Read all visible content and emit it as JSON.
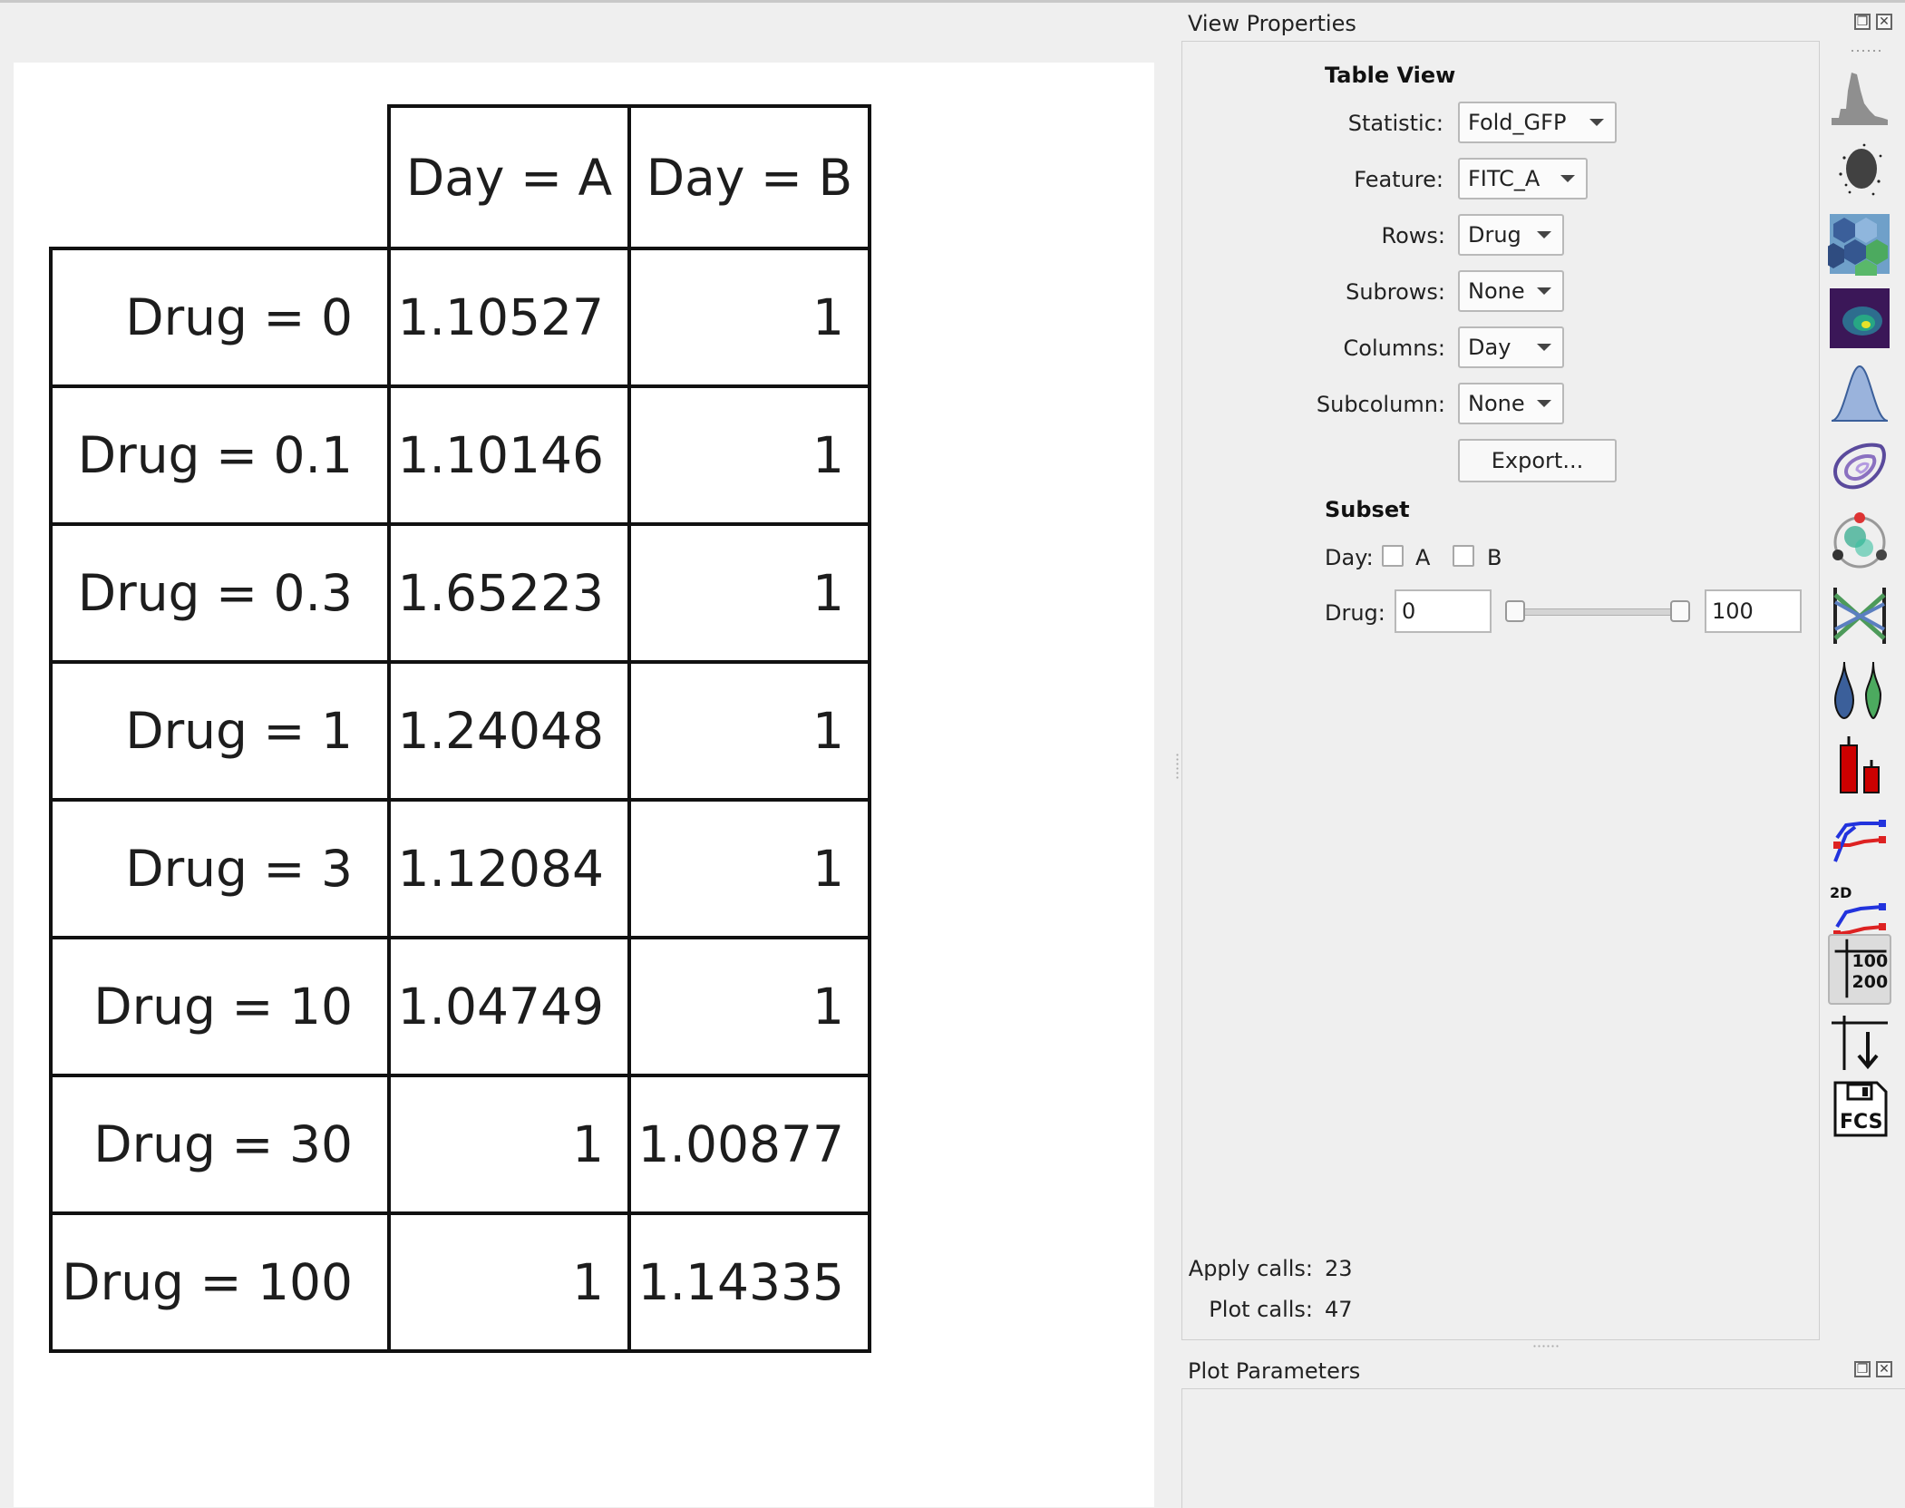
{
  "table": {
    "column_headers": [
      "Day = A",
      "Day = B"
    ],
    "rows": [
      {
        "label": "Drug = 0",
        "a": "1.10527",
        "b": "1"
      },
      {
        "label": "Drug = 0.1",
        "a": "1.10146",
        "b": "1"
      },
      {
        "label": "Drug = 0.3",
        "a": "1.65223",
        "b": "1"
      },
      {
        "label": "Drug = 1",
        "a": "1.24048",
        "b": "1"
      },
      {
        "label": "Drug = 3",
        "a": "1.12084",
        "b": "1"
      },
      {
        "label": "Drug = 10",
        "a": "1.04749",
        "b": "1"
      },
      {
        "label": "Drug = 30",
        "a": "1",
        "b": "1.00877"
      },
      {
        "label": "Drug = 100",
        "a": "1",
        "b": "1.14335"
      }
    ]
  },
  "view_properties": {
    "title": "View Properties",
    "section": "Table View",
    "statistic": {
      "label": "Statistic:",
      "value": "Fold_GFP"
    },
    "feature": {
      "label": "Feature:",
      "value": "FITC_A"
    },
    "rows": {
      "label": "Rows:",
      "value": "Drug"
    },
    "subrows": {
      "label": "Subrows:",
      "value": "None"
    },
    "columns": {
      "label": "Columns:",
      "value": "Day"
    },
    "subcolumn": {
      "label": "Subcolumn:",
      "value": "None"
    },
    "export_label": "Export...",
    "subset_title": "Subset",
    "day_label": "Day:",
    "day_options": [
      "A",
      "B"
    ],
    "drug_label": "Drug:",
    "drug_min": "0",
    "drug_max": "100",
    "apply_calls_label": "Apply calls:",
    "apply_calls": "23",
    "plot_calls_label": "Plot calls:",
    "plot_calls": "47"
  },
  "plot_parameters": {
    "title": "Plot Parameters"
  },
  "toolbar": {
    "tools": [
      "histogram-icon",
      "scatter-icon",
      "hexbin-icon",
      "density-2d-icon",
      "kde-icon",
      "contour-icon",
      "radviz-icon",
      "parallel-coordinates-icon",
      "violin-icon",
      "bar-chart-icon",
      "stats-1d-icon",
      "stats-2d-icon",
      "table-view-icon",
      "export-icon",
      "fcs-icon"
    ],
    "table_icon_text": [
      "100",
      "200"
    ],
    "twod_text": "2D",
    "fcs_text": "FCS"
  }
}
